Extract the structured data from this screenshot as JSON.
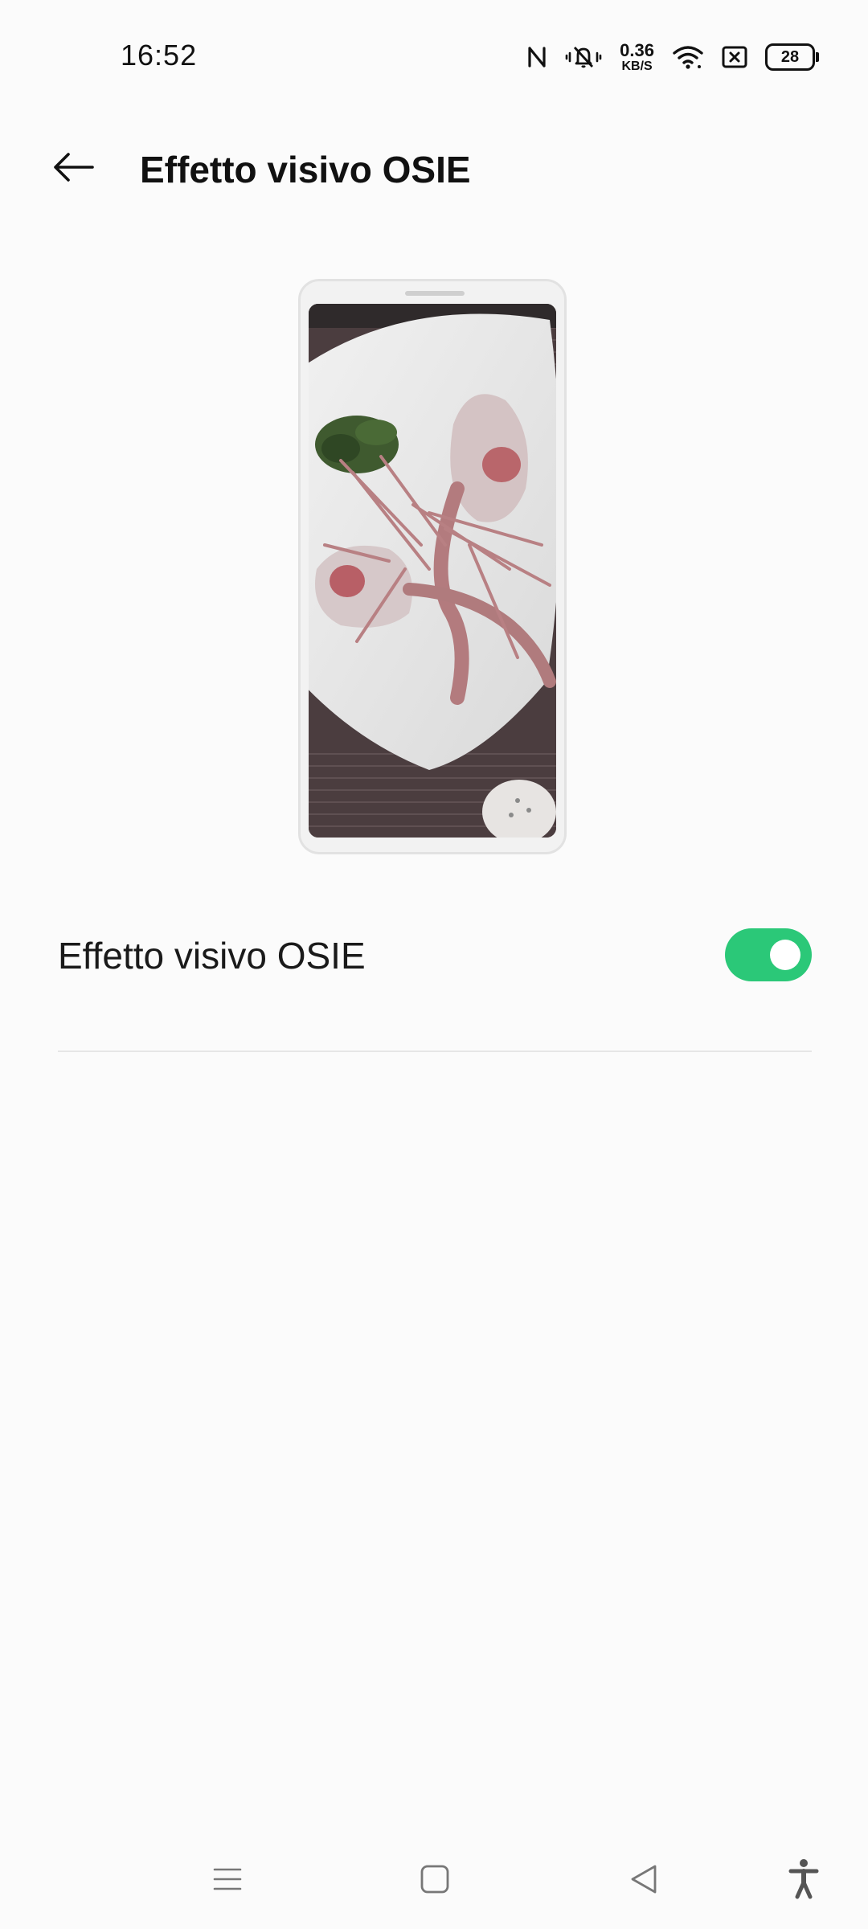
{
  "status_bar": {
    "time": "16:52",
    "net_speed_value": "0.36",
    "net_speed_unit": "KB/S",
    "battery_level": "28",
    "icons": [
      "nfc-icon",
      "vibrate-icon",
      "wifi-icon",
      "sim-off-icon",
      "battery-icon"
    ]
  },
  "header": {
    "title": "Effetto visivo OSIE",
    "back_icon": "back-arrow-icon"
  },
  "preview": {
    "icon": "phone-preview-image"
  },
  "setting": {
    "label": "Effetto visivo OSIE",
    "enabled": true
  },
  "nav_bar": {
    "icons": [
      "menu-icon",
      "home-icon",
      "back-icon",
      "accessibility-icon"
    ]
  },
  "colors": {
    "toggle_on": "#2bc878",
    "background": "#fbfbfb",
    "text": "#111111"
  }
}
